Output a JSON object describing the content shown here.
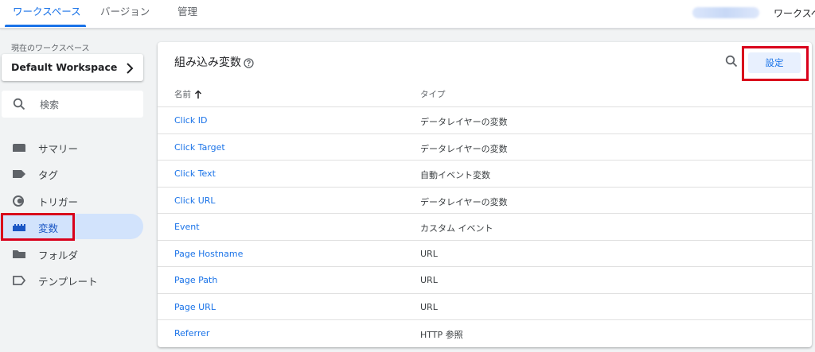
{
  "topbar": {
    "tabs": [
      {
        "label": "ワークスペース"
      },
      {
        "label": "バージョン"
      },
      {
        "label": "管理"
      }
    ],
    "workspace_link": "ワークスペ"
  },
  "sidebar": {
    "current_workspace_label": "現在のワークスペース",
    "workspace_name": "Default Workspace",
    "search_placeholder": "検索",
    "items": [
      {
        "label": "サマリー",
        "icon": "folder-tab-icon"
      },
      {
        "label": "タグ",
        "icon": "tag-icon"
      },
      {
        "label": "トリガー",
        "icon": "trigger-icon"
      },
      {
        "label": "変数",
        "icon": "variable-blocks-icon",
        "active": true
      },
      {
        "label": "フォルダ",
        "icon": "folder-icon"
      },
      {
        "label": "テンプレート",
        "icon": "template-tag-icon"
      }
    ]
  },
  "main": {
    "title": "組み込み変数",
    "settings_label": "設定",
    "columns": {
      "name": "名前",
      "type": "タイプ"
    },
    "rows": [
      {
        "name": "Click ID",
        "type": "データレイヤーの変数"
      },
      {
        "name": "Click Target",
        "type": "データレイヤーの変数"
      },
      {
        "name": "Click Text",
        "type": "自動イベント変数"
      },
      {
        "name": "Click URL",
        "type": "データレイヤーの変数"
      },
      {
        "name": "Event",
        "type": "カスタム イベント"
      },
      {
        "name": "Page Hostname",
        "type": "URL"
      },
      {
        "name": "Page Path",
        "type": "URL"
      },
      {
        "name": "Page URL",
        "type": "URL"
      },
      {
        "name": "Referrer",
        "type": "HTTP 参照"
      }
    ]
  },
  "colors": {
    "accent": "#1a73e8",
    "active_nav_bg": "#d2e3fc",
    "highlight_box": "#d9001b",
    "page_bg": "#f1f3f4"
  }
}
